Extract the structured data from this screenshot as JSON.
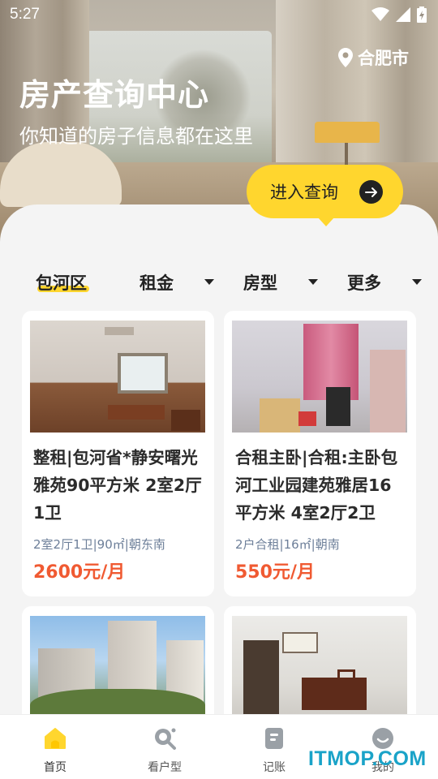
{
  "status_bar": {
    "time": "5:27"
  },
  "hero": {
    "city": "合肥市",
    "title": "房产查询中心",
    "subtitle": "你知道的房子信息都在这里",
    "cta_label": "进入查询"
  },
  "filters": [
    {
      "label": "包河区",
      "has_caret": false,
      "active": true
    },
    {
      "label": "租金",
      "has_caret": true
    },
    {
      "label": "房型",
      "has_caret": true
    },
    {
      "label": "更多",
      "has_caret": true
    }
  ],
  "listings": [
    {
      "title": "整租|包河省*静安曙光雅苑90平方米 2室2厅1卫",
      "meta": "2室2厅1卫|90㎡|朝东南",
      "price": "2600元/月"
    },
    {
      "title": "合租主卧|合租:主卧包河工业园建苑雅居16平方米 4室2厅2卫",
      "meta": "2户合租|16㎡|朝南",
      "price": "550元/月"
    },
    {
      "title": "",
      "meta": "",
      "price": ""
    },
    {
      "title": "",
      "meta": "",
      "price": ""
    }
  ],
  "bottom_nav": [
    {
      "label": "首页",
      "icon": "home-icon",
      "active": true
    },
    {
      "label": "看户型",
      "icon": "search-icon"
    },
    {
      "label": "记账",
      "icon": "notebook-icon"
    },
    {
      "label": "我的",
      "icon": "profile-icon"
    }
  ],
  "watermark": "ITMOP.COM",
  "colors": {
    "accent": "#ffd62e",
    "price": "#f05a32",
    "meta": "#6d7f99"
  }
}
